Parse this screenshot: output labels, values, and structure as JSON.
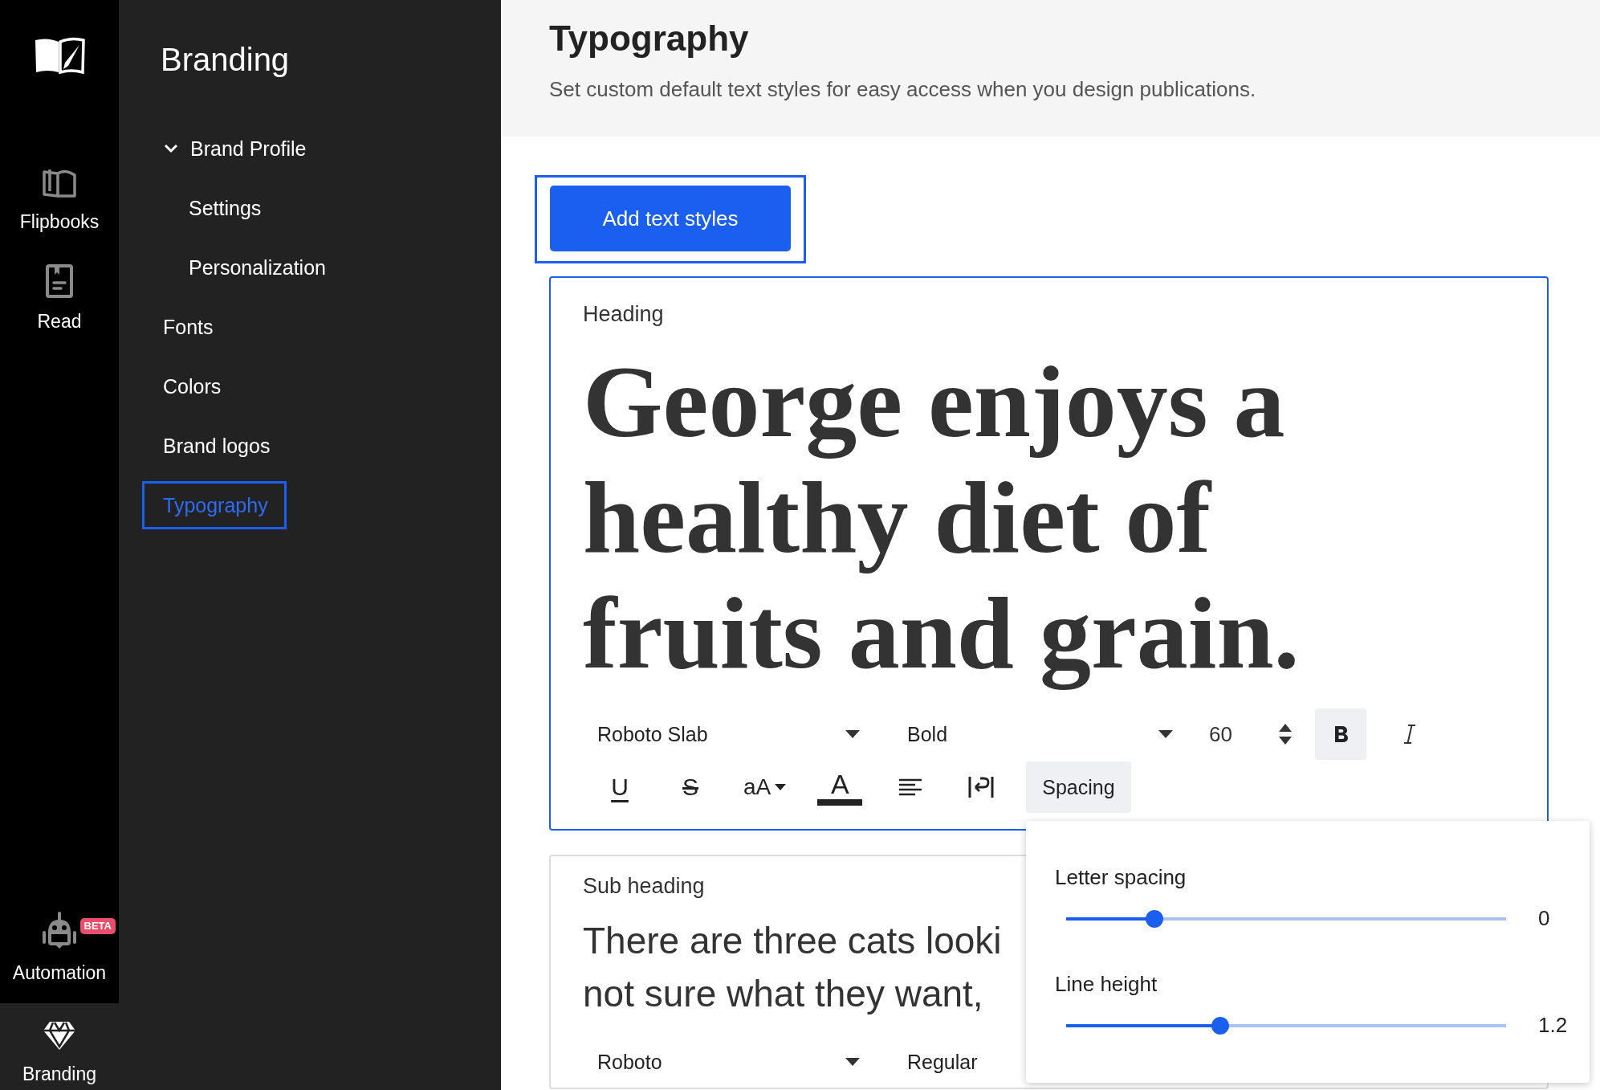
{
  "rail": {
    "items": [
      {
        "kind": "flipbooks",
        "label": "Flipbooks",
        "selected": false
      },
      {
        "kind": "read",
        "label": "Read",
        "selected": false
      },
      {
        "kind": "automation",
        "label": "Automation",
        "badge": "BETA",
        "selected": false
      },
      {
        "kind": "branding",
        "label": "Branding",
        "selected": true
      }
    ]
  },
  "sidebar": {
    "title": "Branding",
    "items": [
      {
        "label": "Brand Profile",
        "expanded": true,
        "selected": false,
        "children": [
          {
            "label": "Settings",
            "selected": false
          },
          {
            "label": "Personalization",
            "selected": false
          }
        ]
      },
      {
        "label": "Fonts",
        "selected": false
      },
      {
        "label": "Colors",
        "selected": false
      },
      {
        "label": "Brand logos",
        "selected": false
      },
      {
        "label": "Typography",
        "selected": true
      }
    ]
  },
  "header": {
    "title": "Typography",
    "subtitle": "Set custom default text styles for easy access when you design publications."
  },
  "add_button": {
    "label": "Add text styles",
    "focused": true
  },
  "styles": [
    {
      "kind": "heading",
      "label": "Heading",
      "selected": true,
      "sample_lines": [
        "George enjoys a",
        "healthy diet of",
        "fruits and grain."
      ],
      "font": "Roboto Slab",
      "weight": "Bold",
      "size": "60",
      "bold": true,
      "italic": false,
      "tools": [
        {
          "kind": "underline",
          "glyph": "U"
        },
        {
          "kind": "strike",
          "glyph": "S"
        },
        {
          "kind": "case",
          "glyph": "aA"
        },
        {
          "kind": "color",
          "glyph": "A"
        },
        {
          "kind": "align"
        },
        {
          "kind": "direction"
        },
        {
          "kind": "spacing",
          "label": "Spacing",
          "selected": true
        }
      ]
    },
    {
      "kind": "subheading",
      "label": "Sub heading",
      "selected": false,
      "sample_lines": [
        "There are three cats looki",
        "not sure what they want,"
      ],
      "font": "Roboto",
      "weight": "Regular"
    }
  ],
  "popover": {
    "sliders": [
      {
        "label": "Letter spacing",
        "level": 0.2,
        "reading": "0"
      },
      {
        "label": "Line height",
        "level": 0.35,
        "reading": "1.2"
      }
    ]
  }
}
